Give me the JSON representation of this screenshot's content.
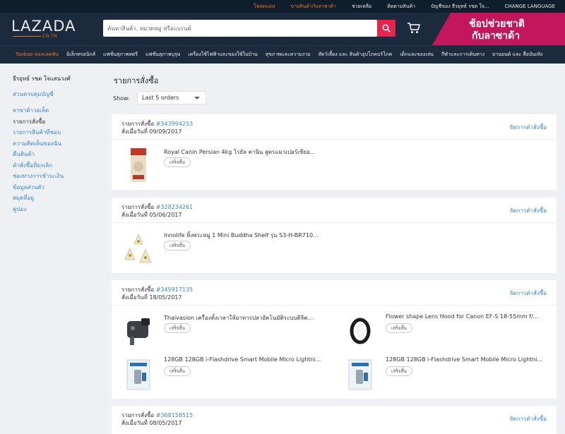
{
  "topbar": {
    "links": [
      "โหลดแอป",
      "ขายสินค้ากับลาซาด้า",
      "ช่วยเหลือ",
      "ติดตามสินค้า",
      "บัญชีของ  ธีรยุทธ์ รชต ใจ...",
      "CHANGE LANGUAGE"
    ]
  },
  "header": {
    "logo_word": "LAZADA",
    "logo_sub": "CO.TH",
    "search_placeholder": "ค้นหาสินค้า, หมวดหมู่ หรือแบรนด์",
    "promo_line1": "ช้อปช่วยชาติ",
    "promo_line2": "กับลาซาด้า"
  },
  "categories": [
    "Taobao คอลเลคชัน",
    "อิเล็กทรอนิกส์",
    "แฟชั่นสุภาพสตรี",
    "แฟชั่นสุภาพบุรุษ",
    "เครื่องใช้ไฟฟ้าและของใช้ในบ้าน",
    "สุขภาพและความงาม",
    "สัตว์เลี้ยง และ สินค้าอุปโภคบริโภค",
    "เด็กและของเล่น",
    "กีฬาและการเดินทาง",
    "ยานยนต์ และ สื่อบันเทิง"
  ],
  "sidebar": {
    "greeting": "ธีรยุทธ์ รชต ใจแสนวงศ์",
    "account": "ส่วนควบคุมบัญชี",
    "items": [
      "ลาซาด้าวอเล็ต",
      "รายการสั่งซื้อ",
      "รายการสินค้าที่ชอบ",
      "ความคิดเห็นของฉัน",
      "คืนสินค้า",
      "คำสั่งซื้อที่ยกเลิก",
      "ช่องทางการชำระเงิน",
      "ข้อมูลส่วนตัว",
      "สมุดที่อยู่",
      "คูปอง"
    ]
  },
  "main": {
    "title": "รายการสั่งซื้อ",
    "show_label": "Show:",
    "show_value": "Last 5 orders",
    "order_label": "รายการสั่งซื้อ",
    "manage_label": "จัดการคำสั่งซื้อ",
    "orders": [
      {
        "number": "#343994253",
        "placed": "สั่งเมื่อวันที่ 09/09/2017",
        "products": [
          {
            "name": "Royal Canin Persian 4kg โรยัล คานิน สูตรแมวเปอร์เซียอ...",
            "status": "เสร็จสิ้น"
          }
        ]
      },
      {
        "number": "#328234261",
        "placed": "สั่งเมื่อวันที่ 05/06/2017",
        "products": [
          {
            "name": "Innolife หิ้งพระหมู่ 1 Mini Buddha Shelf รุ่น S3-H-BR710...",
            "status": "เสร็จสิ้น"
          }
        ]
      },
      {
        "number": "#345917135",
        "placed": "สั่งเมื่อวันที่ 18/05/2017",
        "products": [
          {
            "name": "Thaivasion เครื่องตั้งเวลาให้อาหารปลาอัตโนมัติระบบดิจิต...",
            "status": "เสร็จสิ้น"
          },
          {
            "name": "Flower shape Lens Hood for Canon EF-S 18-55mm f/...",
            "status": "เสร็จสิ้น"
          },
          {
            "name": "128GB 128GB i-Flashdrive Smart Mobile Micro Lightni...",
            "status": "เสร็จสิ้น"
          },
          {
            "name": "128GB 128GB i-Flashdrive Smart Mobile Micro Lightni...",
            "status": "เสร็จสิ้น"
          }
        ]
      },
      {
        "number": "#368158515",
        "placed": "สั่งเมื่อวันที่ 08/05/2017",
        "products": []
      }
    ]
  },
  "colors": {
    "header_bg": "#1b2b3d",
    "accent_orange": "#f57224",
    "search_pink": "#e6254e",
    "link_blue": "#3a88c8",
    "promo_magenta": "#c2185b"
  }
}
